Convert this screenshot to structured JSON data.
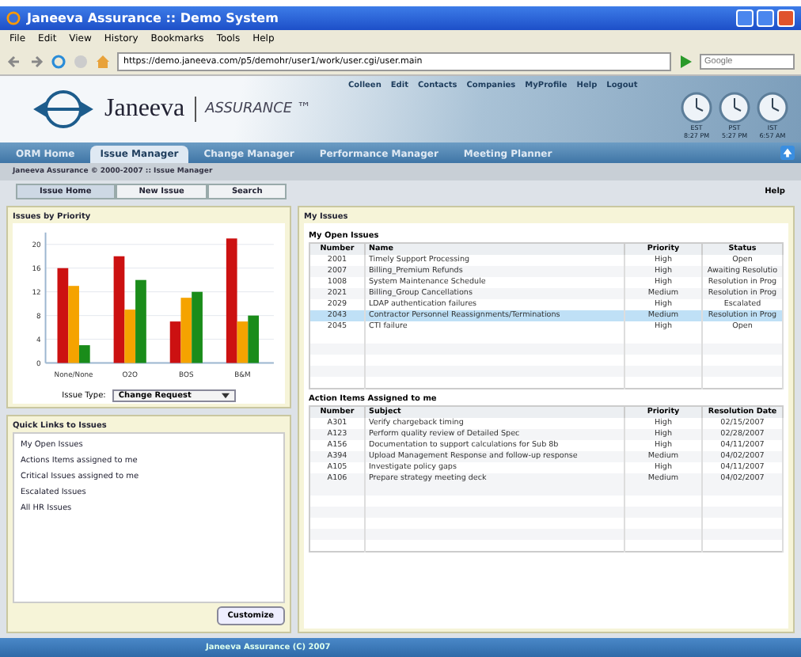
{
  "window": {
    "title": "Janeeva Assurance :: Demo System"
  },
  "menu": [
    "File",
    "Edit",
    "View",
    "History",
    "Bookmarks",
    "Tools",
    "Help"
  ],
  "address": {
    "value": "https://demo.janeeva.com/p5/demohr/user1/work/user.cgi/user.main"
  },
  "web_search": {
    "placeholder": "Google"
  },
  "header": {
    "brand": "Janeeva",
    "product": "ASSURANCE ™",
    "links": [
      "Colleen",
      "Edit",
      "Contacts",
      "Companies",
      "MyProfile",
      "Help",
      "Logout"
    ],
    "clocks": [
      {
        "zone": "EST",
        "time": "8:27 PM"
      },
      {
        "zone": "PST",
        "time": "5:27 PM"
      },
      {
        "zone": "IST",
        "time": "6:57 AM"
      }
    ]
  },
  "tabs": [
    {
      "label": "ORM Home",
      "selected": false
    },
    {
      "label": "Issue Manager",
      "selected": true
    },
    {
      "label": "Change Manager",
      "selected": false
    },
    {
      "label": "Performance Manager",
      "selected": false
    },
    {
      "label": "Meeting Planner",
      "selected": false
    }
  ],
  "breadcrumb": "Janeeva Assurance © 2000-2007 :: Issue Manager",
  "subtabs": [
    {
      "label": "Issue Home",
      "selected": true
    },
    {
      "label": "New Issue",
      "selected": false
    },
    {
      "label": "Search",
      "selected": false
    }
  ],
  "help": "Help",
  "priority_panel": {
    "title": "Issues by Priority",
    "issue_type_label": "Issue Type:",
    "issue_type": "Change Request",
    "chart_data": {
      "type": "bar",
      "grid": true,
      "categories": [
        "None/None",
        "O2O",
        "BOS",
        "B&M"
      ],
      "yticks": [
        0,
        4,
        8,
        12,
        16,
        20
      ],
      "ylim": [
        0,
        22
      ],
      "series": [
        {
          "color": "#cc1111",
          "values": [
            16,
            18,
            7,
            21
          ]
        },
        {
          "color": "#f5a300",
          "values": [
            13,
            9,
            11,
            7
          ]
        },
        {
          "color": "#1a8c1a",
          "values": [
            3,
            14,
            12,
            8
          ]
        }
      ]
    }
  },
  "quick_links": {
    "title": "Quick Links to Issues",
    "items": [
      "My Open Issues",
      "Actions Items assigned to me",
      "Critical Issues assigned to me",
      "Escalated Issues",
      "All HR Issues"
    ],
    "button": "Customize"
  },
  "my_issues": {
    "title": "My Issues",
    "open_title": "My Open Issues",
    "columns": [
      "Number",
      "Name",
      "Priority",
      "Status"
    ],
    "rows": [
      {
        "cells": [
          "2001",
          "Timely Support Processing",
          "High",
          "Open"
        ],
        "selected": false
      },
      {
        "cells": [
          "2007",
          "Billing_Premium Refunds",
          "High",
          "Awaiting Resolutio"
        ],
        "selected": false
      },
      {
        "cells": [
          "1008",
          "System Maintenance Schedule",
          "High",
          "Resolution in Prog"
        ],
        "selected": false
      },
      {
        "cells": [
          "2021",
          "Billing_Group Cancellations",
          "Medium",
          "Resolution in Prog"
        ],
        "selected": false
      },
      {
        "cells": [
          "2029",
          "LDAP authentication failures",
          "High",
          "Escalated"
        ],
        "selected": false
      },
      {
        "cells": [
          "2043",
          "Contractor Personnel Reassignments/Terminations",
          "Medium",
          "Resolution in Prog"
        ],
        "selected": true
      },
      {
        "cells": [
          "2045",
          "CTI failure",
          "High",
          "Open"
        ],
        "selected": false
      }
    ]
  },
  "action_items": {
    "title": "Action Items Assigned to me",
    "columns": [
      "Number",
      "Subject",
      "Priority",
      "Resolution Date"
    ],
    "rows": [
      [
        "A301",
        "Verify chargeback timing",
        "High",
        "02/15/2007"
      ],
      [
        "A123",
        "Perform quality review of Detailed Spec",
        "High",
        "02/28/2007"
      ],
      [
        "A156",
        "Documentation to support calculations for Sub 8b",
        "High",
        "04/11/2007"
      ],
      [
        "A394",
        "Upload Management Response and follow-up response",
        "Medium",
        "04/02/2007"
      ],
      [
        "A105",
        "Investigate policy gaps",
        "High",
        "04/11/2007"
      ],
      [
        "A106",
        "Prepare strategy meeting deck",
        "Medium",
        "04/02/2007"
      ]
    ]
  },
  "footer": "Janeeva Assurance (C) 2007"
}
